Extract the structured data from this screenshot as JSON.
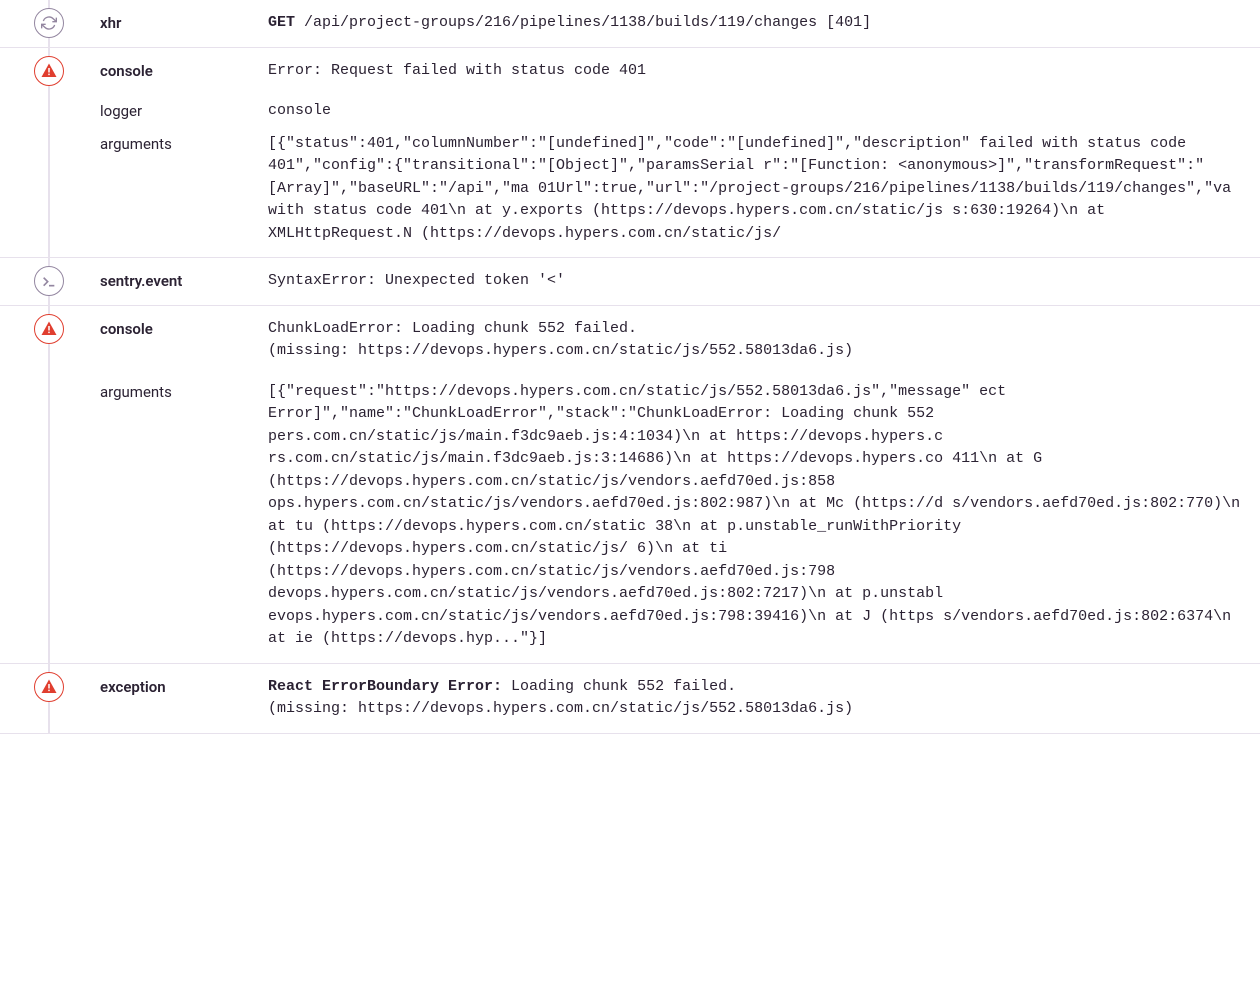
{
  "items": [
    {
      "icon": "refresh",
      "severity": "gray",
      "category": "xhr",
      "message_method": "GET",
      "message_path": " /api/project-groups/216/pipelines/1138/builds/119/changes [401]"
    },
    {
      "icon": "warning",
      "severity": "red",
      "category": "console",
      "message": "Error: Request failed with status code 401",
      "details": [
        {
          "label": "logger",
          "value": "console"
        },
        {
          "label": "arguments",
          "value": "[{\"status\":401,\"columnNumber\":\"[undefined]\",\"code\":\"[undefined]\",\"description\" failed with status code 401\",\"config\":{\"transitional\":\"[Object]\",\"paramsSerial r\":\"[Function: <anonymous>]\",\"transformRequest\":\"[Array]\",\"baseURL\":\"/api\",\"ma 01Url\":true,\"url\":\"/project-groups/216/pipelines/1138/builds/119/changes\",\"va with status code 401\\n    at y.exports (https://devops.hypers.com.cn/static/js s:630:19264)\\n    at XMLHttpRequest.N (https://devops.hypers.com.cn/static/js/"
        }
      ]
    },
    {
      "icon": "terminal",
      "severity": "gray",
      "category": "sentry.event",
      "message": "SyntaxError: Unexpected token '<'"
    },
    {
      "icon": "warning",
      "severity": "red",
      "category": "console",
      "message": "ChunkLoadError: Loading chunk 552 failed.\n(missing: https://devops.hypers.com.cn/static/js/552.58013da6.js)",
      "details": [
        {
          "label": "arguments",
          "value": "[{\"request\":\"https://devops.hypers.com.cn/static/js/552.58013da6.js\",\"message\" ect Error]\",\"name\":\"ChunkLoadError\",\"stack\":\"ChunkLoadError: Loading chunk 552 pers.com.cn/static/js/main.f3dc9aeb.js:4:1034)\\n    at https://devops.hypers.c rs.com.cn/static/js/main.f3dc9aeb.js:3:14686)\\n    at https://devops.hypers.co 411\\n    at G (https://devops.hypers.com.cn/static/js/vendors.aefd70ed.js:858 ops.hypers.com.cn/static/js/vendors.aefd70ed.js:802:987)\\n    at Mc (https://d s/vendors.aefd70ed.js:802:770)\\n    at tu (https://devops.hypers.com.cn/static 38\\n    at p.unstable_runWithPriority (https://devops.hypers.com.cn/static/js/ 6)\\n    at ti (https://devops.hypers.com.cn/static/js/vendors.aefd70ed.js:798 devops.hypers.com.cn/static/js/vendors.aefd70ed.js:802:7217)\\n    at p.unstabl evops.hypers.com.cn/static/js/vendors.aefd70ed.js:798:39416)\\n    at J (https s/vendors.aefd70ed.js:802:6374\\n    at ie (https://devops.hyp...\"}]"
        }
      ]
    },
    {
      "icon": "warning",
      "severity": "red",
      "category": "exception",
      "message_strong": "React ErrorBoundary Error: ",
      "message_rest": "Loading chunk 552 failed.\n(missing: https://devops.hypers.com.cn/static/js/552.58013da6.js)"
    }
  ]
}
